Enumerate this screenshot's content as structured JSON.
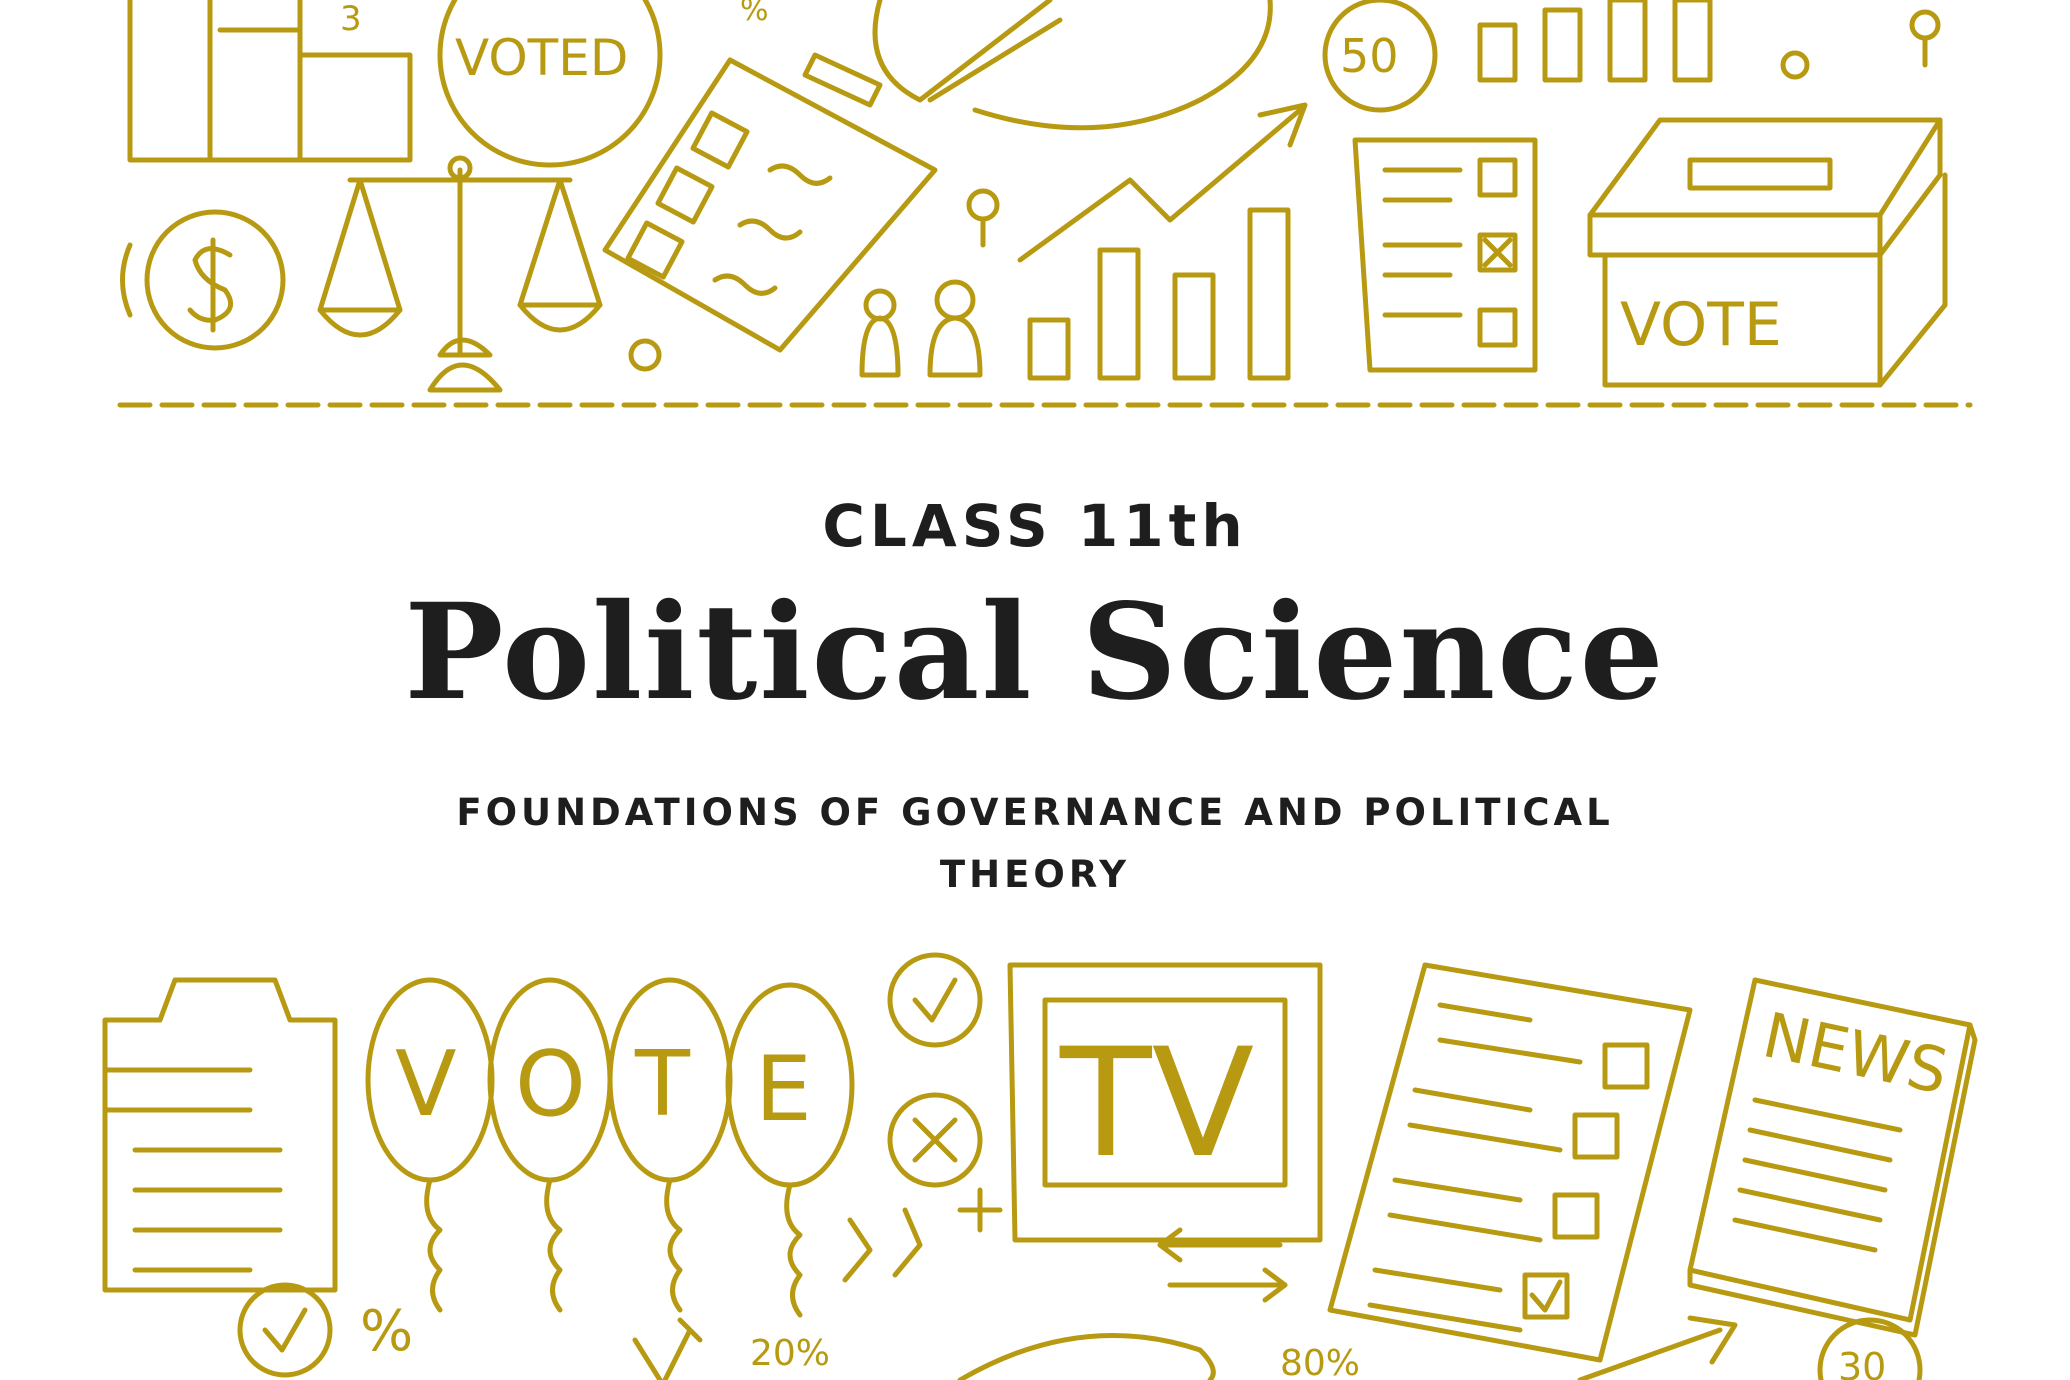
{
  "header": {
    "class_label": "CLASS 11th",
    "title": "Political Science",
    "subtitle": "FOUNDATIONS OF GOVERNANCE AND POLITICAL THEORY"
  },
  "doodle_text": {
    "voted_badge": "VOTED",
    "coin_50": "50",
    "ballot_box": "VOTE",
    "number_3": "3",
    "balloon_v": "V",
    "balloon_o": "O",
    "balloon_t": "T",
    "balloon_e": "E",
    "tv_screen": "TV",
    "newspaper": "NEWS",
    "pct_20": "20%",
    "pct_80": "80%",
    "coin_30": "30",
    "percent_sign": "%"
  },
  "colors": {
    "doodle": "#b89a12",
    "text": "#1e1e1e",
    "background": "#ffffff"
  }
}
